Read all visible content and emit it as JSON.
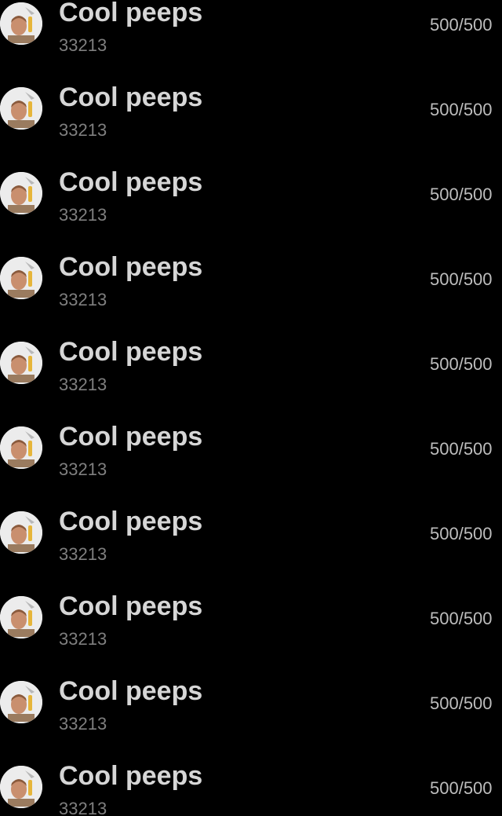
{
  "chats": [
    {
      "title": "Cool peeps",
      "subtitle": "33213",
      "count": "500/500",
      "avatar_icon": "group-avatar-icon"
    },
    {
      "title": "Cool peeps",
      "subtitle": "33213",
      "count": "500/500",
      "avatar_icon": "group-avatar-icon"
    },
    {
      "title": "Cool peeps",
      "subtitle": "33213",
      "count": "500/500",
      "avatar_icon": "group-avatar-icon"
    },
    {
      "title": "Cool peeps",
      "subtitle": "33213",
      "count": "500/500",
      "avatar_icon": "group-avatar-icon"
    },
    {
      "title": "Cool peeps",
      "subtitle": "33213",
      "count": "500/500",
      "avatar_icon": "group-avatar-icon"
    },
    {
      "title": "Cool peeps",
      "subtitle": "33213",
      "count": "500/500",
      "avatar_icon": "group-avatar-icon"
    },
    {
      "title": "Cool peeps",
      "subtitle": "33213",
      "count": "500/500",
      "avatar_icon": "group-avatar-icon"
    },
    {
      "title": "Cool peeps",
      "subtitle": "33213",
      "count": "500/500",
      "avatar_icon": "group-avatar-icon"
    },
    {
      "title": "Cool peeps",
      "subtitle": "33213",
      "count": "500/500",
      "avatar_icon": "group-avatar-icon"
    },
    {
      "title": "Cool peeps",
      "subtitle": "33213",
      "count": "500/500",
      "avatar_icon": "group-avatar-icon"
    }
  ],
  "colors": {
    "background": "#000000",
    "title": "#d6d6d6",
    "subtitle": "#7f7f7f",
    "count": "#bdbdbd",
    "avatar_bg": "#ececec"
  }
}
